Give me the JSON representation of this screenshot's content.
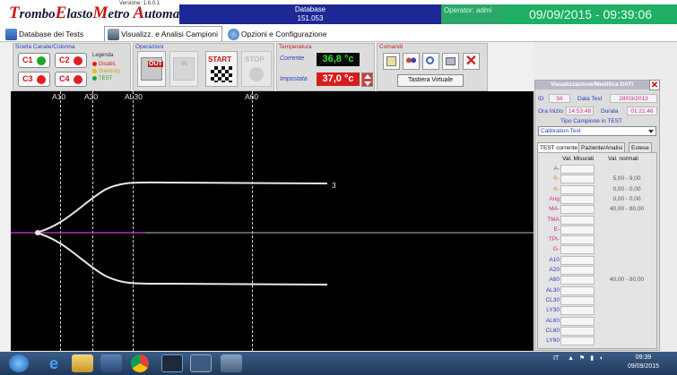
{
  "titlebar": {
    "logo_t": "T",
    "logo_rombo": "rombo",
    "logo_e": "E",
    "logo_lasto": "lasto",
    "logo_m": "M",
    "logo_etro": "etro",
    "logo_a": "A",
    "logo_utom": "utomatizzato",
    "version": "Versione: 1.6.0.1",
    "database_label": "Database",
    "database_value": "151.053",
    "operator": "Operator: admi",
    "datetime": "09/09/2015 - 09:39:06"
  },
  "tabs": [
    {
      "label": "Database dei Tests"
    },
    {
      "label": "Visualizz. e Analisi Campioni"
    },
    {
      "label": "Opzioni e Configurazione"
    }
  ],
  "panels": {
    "channel": {
      "title": "Scelta Canale/Colonna",
      "channels": [
        {
          "label": "C1",
          "color": "#1fa52a"
        },
        {
          "label": "C2",
          "color": "#e02020"
        },
        {
          "label": "C3",
          "color": "#e02020"
        },
        {
          "label": "C4",
          "color": "#e02020"
        }
      ],
      "legend_title": "Legenda",
      "legend": [
        {
          "label": "Disabil.",
          "color": "#e02020"
        },
        {
          "label": "Stand-by",
          "color": "#e8c000"
        },
        {
          "label": "TEST",
          "color": "#1fa52a"
        }
      ]
    },
    "operations": {
      "title": "Operazioni",
      "buttons": [
        "OUT",
        "IN",
        "START",
        "STOP"
      ]
    },
    "temperature": {
      "title": "Temperatura",
      "current_label": "Corrente",
      "current_value": "36,8 °c",
      "set_label": "Impostata",
      "set_value": "37,0 °c"
    },
    "commands": {
      "title": "Comandi",
      "keyboard_button": "Tastiera Virtuale"
    }
  },
  "plot": {
    "markers": [
      "A10",
      "A20",
      "AL30",
      "A60"
    ],
    "curve_label": "3"
  },
  "side_panel": {
    "title": "Visualizzazione/Modifica DATI",
    "id_label": "ID",
    "id_value": "56",
    "date_label": "Data Test",
    "date_value": "28/03/2013",
    "start_label": "Ora Inizio",
    "start_value": "14:53:48",
    "duration_label": "Durata",
    "duration_value": "01:21:46",
    "sample_type_label": "Tipo Campione in TEST",
    "sample_type_value": "Calibration Test",
    "tabs": [
      "TEST corrente",
      "Paziente/Analisi",
      "Estese"
    ],
    "col_measured": "Val. Misurati",
    "col_normal": "Val. normali",
    "rows": [
      {
        "label": "A-",
        "color": "#2c9c2c",
        "normal": ""
      },
      {
        "label": "R-",
        "color": "#d09020",
        "normal": "5,00 - 9,00"
      },
      {
        "label": "K-",
        "color": "#d09020",
        "normal": "0,00 - 0,00"
      },
      {
        "label": "Ang",
        "color": "#d02c8c",
        "normal": "0,00 - 0,00"
      },
      {
        "label": "MA-",
        "color": "#d02c8c",
        "normal": "40,00 - 80,00"
      },
      {
        "label": "TMA",
        "color": "#d02c8c",
        "normal": ""
      },
      {
        "label": "E-",
        "color": "#d02c8c",
        "normal": ""
      },
      {
        "label": "TPI-",
        "color": "#d02c8c",
        "normal": ""
      },
      {
        "label": "G-",
        "color": "#d02c8c",
        "normal": ""
      },
      {
        "label": "A10",
        "color": "#2a3fbf",
        "normal": ""
      },
      {
        "label": "A20",
        "color": "#2a3fbf",
        "normal": ""
      },
      {
        "label": "A60",
        "color": "#2a3fbf",
        "normal": "40,00 - 80,00"
      },
      {
        "label": "AL30",
        "color": "#2a3fbf",
        "normal": ""
      },
      {
        "label": "CL30",
        "color": "#2a3fbf",
        "normal": ""
      },
      {
        "label": "LY30",
        "color": "#2a3fbf",
        "normal": ""
      },
      {
        "label": "AL60",
        "color": "#2a3fbf",
        "normal": ""
      },
      {
        "label": "CL60",
        "color": "#2a3fbf",
        "normal": ""
      },
      {
        "label": "LY60",
        "color": "#2a3fbf",
        "normal": ""
      }
    ]
  },
  "taskbar": {
    "lang": "IT",
    "time": "09:39",
    "date": "09/09/2015"
  }
}
